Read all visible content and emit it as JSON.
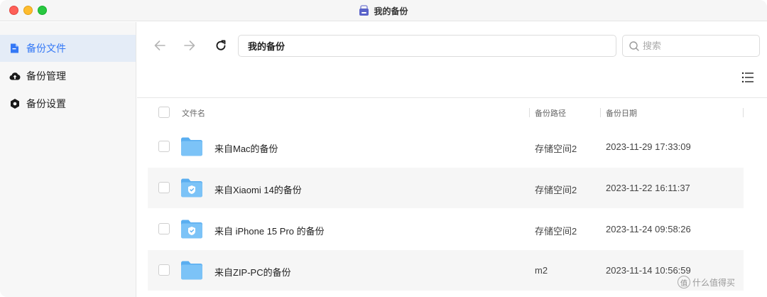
{
  "window": {
    "title": "我的备份"
  },
  "sidebar": {
    "items": [
      {
        "label": "备份文件",
        "icon": "file-icon",
        "active": true
      },
      {
        "label": "备份管理",
        "icon": "cloud-upload-icon",
        "active": false
      },
      {
        "label": "备份设置",
        "icon": "settings-icon",
        "active": false
      }
    ]
  },
  "toolbar": {
    "path": "我的备份",
    "search_placeholder": "搜索"
  },
  "table": {
    "columns": [
      "文件名",
      "备份路径",
      "备份日期"
    ],
    "rows": [
      {
        "name": "来自Mac的备份",
        "path": "存储空间2",
        "date": "2023-11-29 17:33:09",
        "icon": "folder-icon"
      },
      {
        "name": "来自Xiaomi 14的备份",
        "path": "存储空间2",
        "date": "2023-11-22 16:11:37",
        "icon": "shield-folder-icon"
      },
      {
        "name": "来自 iPhone 15 Pro 的备份",
        "path": "存储空间2",
        "date": "2023-11-24 09:58:26",
        "icon": "shield-folder-icon"
      },
      {
        "name": "来自ZIP-PC的备份",
        "path": "m2",
        "date": "2023-11-14 10:56:59",
        "icon": "folder-icon"
      }
    ]
  },
  "watermark": {
    "text": "什么值得买",
    "badge": "值"
  },
  "colors": {
    "accent": "#3478f6",
    "folder": "#6cbaf5",
    "active_bg": "#e4ecf7"
  }
}
